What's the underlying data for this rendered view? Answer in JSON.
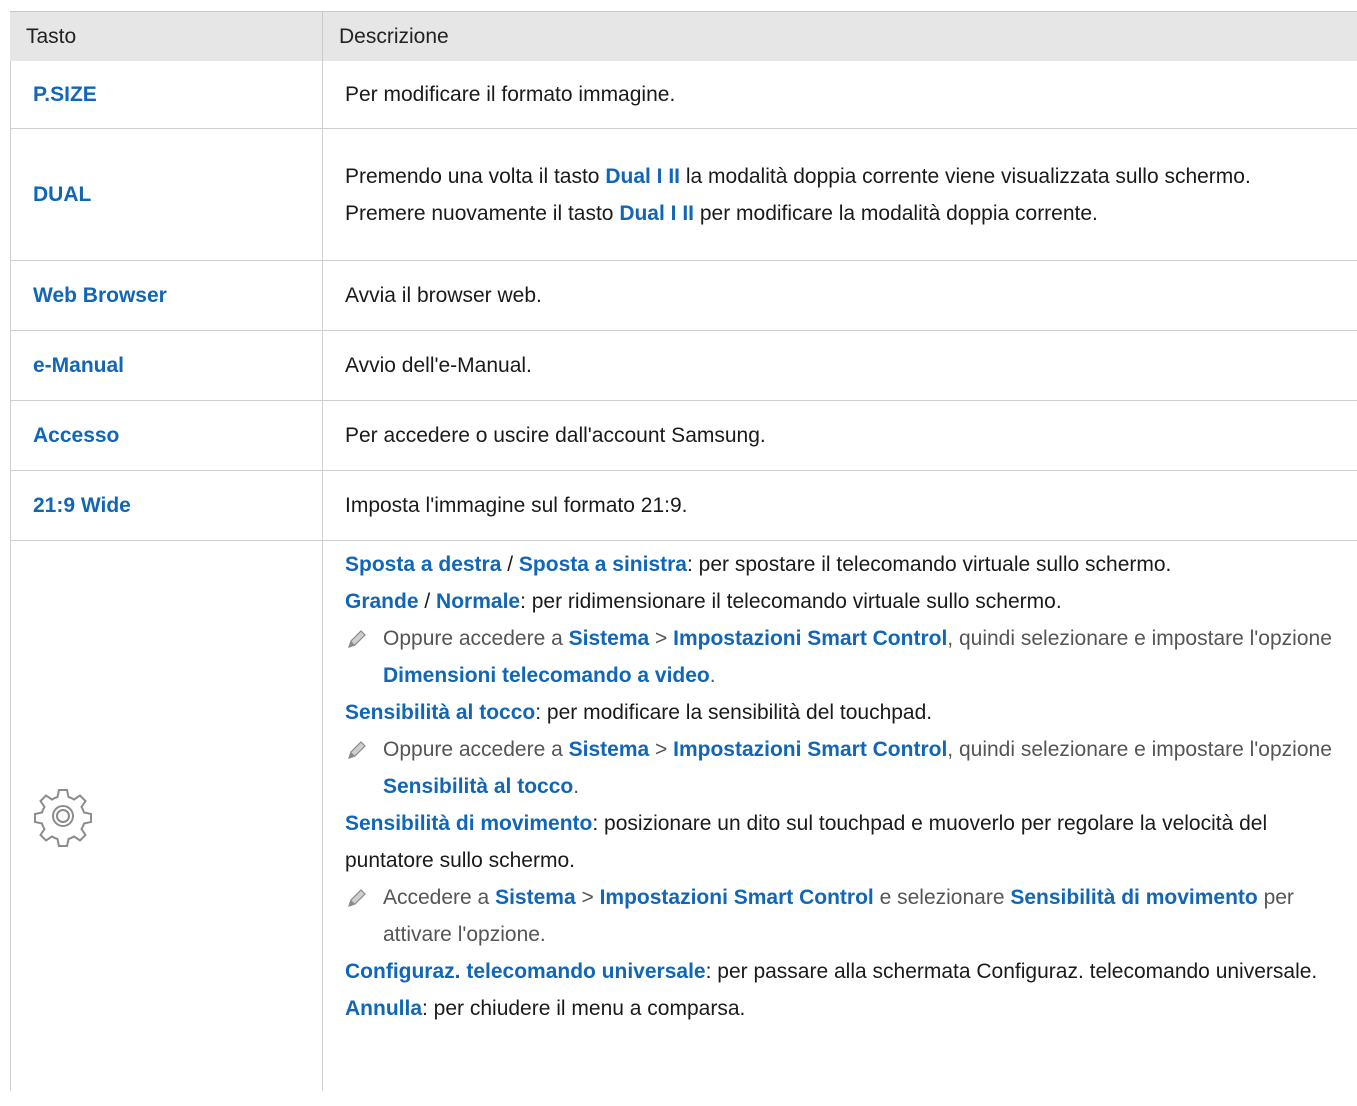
{
  "header": {
    "col1": "Tasto",
    "col2": "Descrizione"
  },
  "rows": [
    {
      "key": "P.SIZE",
      "desc": "Per modificare il formato immagine."
    },
    {
      "key": "DUAL",
      "d1a": "Premendo una volta il tasto ",
      "d1b": "Dual I II",
      "d1c": " la modalità doppia corrente viene visualizzata sullo schermo.",
      "d2a": "Premere nuovamente il tasto ",
      "d2b": "Dual I II",
      "d2c": " per modificare la modalità doppia corrente."
    },
    {
      "key": "Web Browser",
      "desc": "Avvia il browser web."
    },
    {
      "key": "e-Manual",
      "desc": "Avvio dell'e-Manual."
    },
    {
      "key": "Accesso",
      "desc": "Per accedere o uscire dall'account Samsung."
    },
    {
      "key": "21:9 Wide",
      "desc": "Imposta l'immagine sul formato 21:9."
    }
  ],
  "settings": {
    "icon": "gear-icon",
    "l1": {
      "a": "Sposta a destra",
      "b": " / ",
      "c": "Sposta a sinistra",
      "d": ": per spostare il telecomando virtuale sullo schermo."
    },
    "l2": {
      "a": "Grande",
      "b": " / ",
      "c": "Normale",
      "d": ": per ridimensionare il telecomando virtuale sullo schermo."
    },
    "n1": {
      "a": "Oppure accedere a ",
      "b": "Sistema",
      "c": " > ",
      "d": "Impostazioni Smart Control",
      "e": ", quindi selezionare e impostare l'opzione ",
      "f": "Dimensioni telecomando a video",
      "g": "."
    },
    "l3": {
      "a": "Sensibilità al tocco",
      "b": ": per modificare la sensibilità del touchpad."
    },
    "n2": {
      "a": "Oppure accedere a ",
      "b": "Sistema",
      "c": " > ",
      "d": "Impostazioni Smart Control",
      "e": ", quindi selezionare e impostare l'opzione ",
      "f": "Sensibilità al tocco",
      "g": "."
    },
    "l4": {
      "a": "Sensibilità di movimento",
      "b": ": posizionare un dito sul touchpad e muoverlo per regolare la velocità del puntatore sullo schermo."
    },
    "n3": {
      "a": "Accedere a ",
      "b": "Sistema",
      "c": " > ",
      "d": "Impostazioni Smart Control",
      "e": " e selezionare ",
      "f": "Sensibilità di movimento",
      "g": " per attivare l'opzione."
    },
    "l5": {
      "a": "Configuraz. telecomando universale",
      "b": ": per passare alla schermata Configuraz. telecomando universale."
    },
    "l6": {
      "a": "Annulla",
      "b": ": per chiudere il menu a comparsa."
    }
  },
  "colors": {
    "accent": "#1166b8",
    "header_bg": "#e6e6e6",
    "border": "#d0d0d0"
  }
}
